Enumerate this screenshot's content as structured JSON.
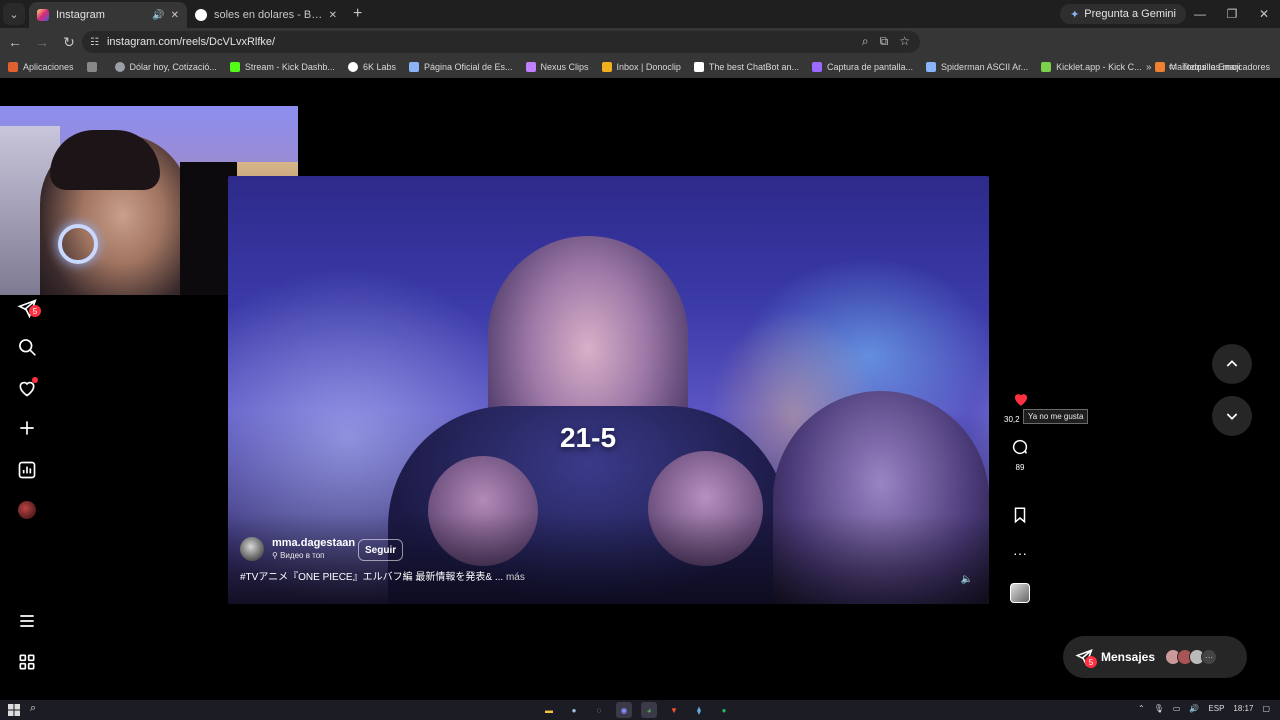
{
  "browser": {
    "tabs": [
      {
        "title": "Instagram",
        "active": true,
        "favicon_color": "#d6249f"
      },
      {
        "title": "soles en dolares - Buscar con G",
        "active": false,
        "favicon_color": "#4285f4"
      }
    ],
    "gemini_label": "Pregunta a Gemini",
    "url": "instagram.com/reels/DcVLvxRlfke/",
    "bookmarks": [
      {
        "label": "Aplicaciones",
        "color": "#e06030"
      },
      {
        "label": "",
        "color": "#888888"
      },
      {
        "label": "Dólar hoy, Cotizació...",
        "color": "#9aa0a6"
      },
      {
        "label": "Stream - Kick Dashb...",
        "color": "#53fc18"
      },
      {
        "label": "6K Labs",
        "color": "#ffffff"
      },
      {
        "label": "Página Oficial de Es...",
        "color": "#8ab4f8"
      },
      {
        "label": "Nexus Clips",
        "color": "#c080ff"
      },
      {
        "label": "Inbox | Donoclip",
        "color": "#f0b020"
      },
      {
        "label": "The best ChatBot an...",
        "color": "#ffffff"
      },
      {
        "label": "Captura de pantalla...",
        "color": "#9b6bff"
      },
      {
        "label": "Spiderman ASCII Ar...",
        "color": "#8ab4f8"
      },
      {
        "label": "Kicklet.app - Kick C...",
        "color": "#7ad14a"
      },
      {
        "label": "Mantequilla Emoji",
        "color": "#f08030"
      }
    ],
    "bookmarks_more": "»",
    "all_bookmarks": "Todos los marcadores"
  },
  "sidebar": {
    "messages_badge": "5"
  },
  "reel": {
    "score_overlay": "21-5",
    "owner": "mma.dagestaan",
    "location": "Видео в топ",
    "follow_label": "Seguir",
    "caption": "#TVアニメ『ONE PIECE』エルバフ編 最新情報を発表& ...",
    "caption_more": "más"
  },
  "actions": {
    "likes": "30,2",
    "like_tooltip": "Ya no me gusta",
    "comments": "89"
  },
  "messages": {
    "label": "Mensajes",
    "badge": "5",
    "more": "···"
  },
  "taskbar": {
    "language": "ESP",
    "time": "18:17"
  },
  "colors": {
    "like_red": "#ff3040",
    "badge_red": "#ff3040"
  }
}
